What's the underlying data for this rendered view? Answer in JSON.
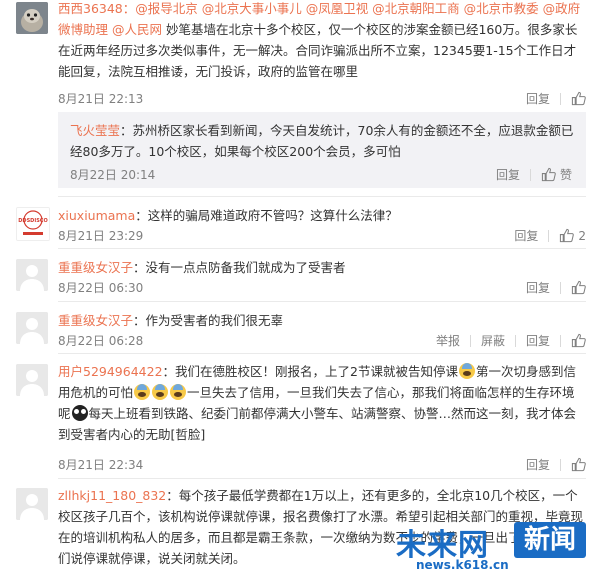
{
  "colors": {
    "username": "#eb7350",
    "text": "#333333",
    "meta": "#808080",
    "reply_bg": "#f2f2f5",
    "watermark": "#1a6cc4"
  },
  "comments": [
    {
      "avatar": "animal-photo-avatar",
      "username": "西西36348",
      "mentions": "：@报导北京 @北京大事小事儿 @凤凰卫视 @北京朝阳工商 @北京市教委 @政府微博助理 @人民网",
      "body": "  妙笔基墙在北京十多个校区，仅一个校区的涉案金额已经160万。很多家长在近两年经历过多次类似事件，无一解决。合同诈骗派出所不立案，12345要1-15个工作日才能回复，法院互相推诿，无门投诉，政府的监管在哪里",
      "time": "8月21日 22:13",
      "reply": "回复",
      "like_count": ""
    },
    {
      "username": "飞火莹莹",
      "body": "：苏州桥区家长看到新闻，今天自发统计，70余人有的金额还不全，应退款金额已经80多万了。10个校区，如果每个校区200个会员，多可怕",
      "time": "8月22日 20:14",
      "reply": "回复",
      "like_label": "赞"
    },
    {
      "avatar": "ddsdisco-logo-avatar",
      "avatar_text": "DDSDISCO",
      "username": "xiuxiumama",
      "body": "：这样的骗局难道政府不管吗？这算什么法律？",
      "time": "8月21日 23:29",
      "reply": "回复",
      "like_count": "2"
    },
    {
      "avatar": "default-avatar",
      "username": "重重级女汉子",
      "body": "：没有一点点防备我们就成为了受害者",
      "time": "8月22日 06:30",
      "reply": "回复",
      "like_count": ""
    },
    {
      "avatar": "default-avatar",
      "username": "重重级女汉子",
      "body": "：作为受害者的我们很无辜",
      "time": "8月22日 06:28",
      "report": "举报",
      "block": "屏蔽",
      "reply": "回复",
      "like_count": ""
    },
    {
      "avatar": "default-avatar",
      "username": "用户5294964422",
      "body_1": "：我们在德胜校区！刚报名，上了2节课就被告知停课",
      "body_2": "第一次切身感到信用危机的可怕",
      "body_3": "一旦失去了信用，一旦我们失去了信心，那我们将面临怎样的生存环境呢",
      "body_4": "每天上班看到铁路、纪委门前都停满大小警车、站满警察、协警…然而这一刻，我才体会到受害者内心的无助[哲脸]",
      "time": "8月21日 22:34",
      "reply": "回复",
      "like_count": ""
    },
    {
      "avatar": "default-avatar",
      "username": "zllhkj11_180_832",
      "body": "：每个孩子最低学费都在1万以上，还有更多的，全北京10几个校区，一个校区孩子几百个，该机构说停课就停课，报名费像打了水漂。希望引起相关部门的重视，毕竟现在的培训机构私人的居多，而且都是霸王条款，一次缴纳为数不少的学费，一旦出了问题，孩子们说停课就停课，说关闭就关闭。",
      "time": "",
      "reply": "",
      "like_count": ""
    }
  ],
  "watermark": {
    "title": "未来网",
    "badge": "新闻",
    "url": "news.k618.cn"
  }
}
